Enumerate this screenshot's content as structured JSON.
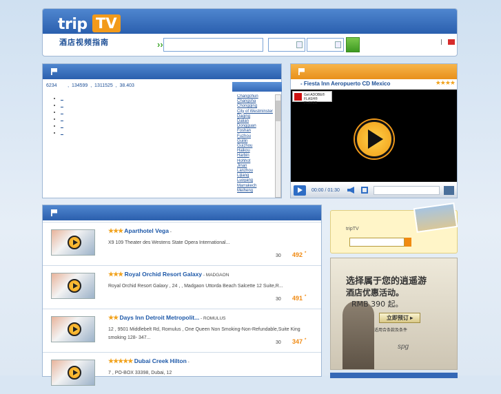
{
  "header": {
    "logo_trip": "trip",
    "logo_tv": "TV",
    "logo_subtitle": "酒店视频指南",
    "search_arrows": "›››"
  },
  "map_panel": {
    "stats": "6234        ,  134599  ,  1311525  ,  38.403",
    "bullets": [
      "_",
      "_",
      "_",
      "_",
      "_",
      "_"
    ],
    "cities": [
      "Changchun",
      "Changsha",
      "Chongqing",
      "City of Westminster",
      "Daqing",
      "Dalian",
      "Dongguan",
      "Foshan",
      "Fuzhou",
      "Guilin",
      "Guizhou",
      "Haikou",
      "Harbin",
      "Hohhot",
      "Jinan",
      "Lanzhou",
      "Lijiang",
      "Luoyang",
      "Marrakech",
      "Meiheng"
    ]
  },
  "video_panel": {
    "title": "- Fiesta Inn Aeropuerto CD Mexico",
    "stars": "★★★★",
    "flash_text": "Get ADOBE® FLASH® PLAYER",
    "time": "00:00 / 01:30"
  },
  "hotels": [
    {
      "stars": "★★★",
      "name": "Aparthotel Vega",
      "sub": " -",
      "desc": "                   X9  109                                         Theater des Westens       State Opera International...",
      "count": "30",
      "price": "492",
      "unit": "*"
    },
    {
      "stars": "★★★",
      "name": "Royal Orchid Resort Galaxy",
      "sub": " - MADGAON",
      "desc": "          Royal Orchid Resort Galaxy            , 24     ,   ,          Madgaon   Uttorda Beach Salcette        12     Suite,R...",
      "count": "30",
      "price": "491",
      "unit": "*"
    },
    {
      "stars": "★★",
      "name": "Days Inn Detroit Metropolit...",
      "sub": " - ROMULUS",
      "desc": "          12   ,   9501 Middlebelt Rd, Romulus   ,                      One Queen Non Smoking-Non-Refundable,Suite King smoking 128-          347...",
      "count": "30",
      "price": "347",
      "unit": "*"
    },
    {
      "stars": "★★★★★",
      "name": "Dubai Creek Hilton",
      "sub": " -",
      "desc": "                         7  ,   PO-BOX 33398,                           Dubai,      12",
      "count": "",
      "price": "",
      "unit": ""
    }
  ],
  "login": {
    "label": "tripTV"
  },
  "ad": {
    "line1": "选择属于您的逍遥游",
    "line2": "酒店优惠活动。",
    "line3": "RMB 390 起。",
    "button": "立即预订 ▸",
    "line4": "适用合条款及条件",
    "brand": "spg"
  },
  "colors": {
    "brand_blue": "#2a5fae",
    "accent_orange": "#f29a1a",
    "price_orange": "#f08a12",
    "go_green": "#3e9a22"
  }
}
